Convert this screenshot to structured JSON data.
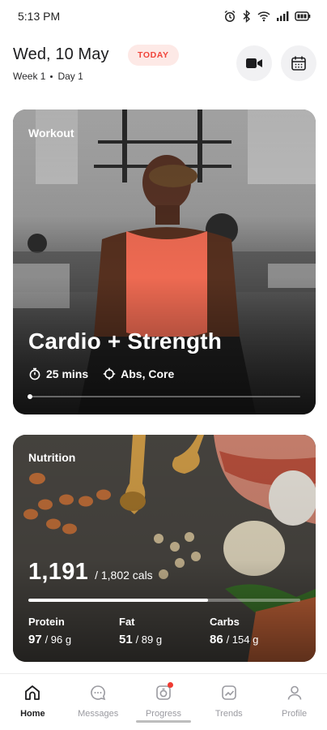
{
  "status_bar": {
    "time": "5:13 PM",
    "icons": [
      "alarm-icon",
      "bluetooth-icon",
      "wifi-icon",
      "signal-icon",
      "battery-icon"
    ]
  },
  "header": {
    "date": "Wed, 10 May",
    "badge": "TODAY",
    "week": "Week 1",
    "day": "Day 1",
    "buttons": [
      "video-camera-icon",
      "calendar-icon"
    ]
  },
  "workout": {
    "label": "Workout",
    "title": "Cardio + Strength",
    "duration": "25 mins",
    "target": "Abs, Core",
    "progress_fraction": 0.0
  },
  "nutrition": {
    "label": "Nutrition",
    "calories": "1,191",
    "goal": "/ 1,802 cals",
    "progress_fraction": 0.66,
    "macros": [
      {
        "label": "Protein",
        "value": "97",
        "goal": "/ 96 g"
      },
      {
        "label": "Fat",
        "value": "51",
        "goal": "/ 89 g"
      },
      {
        "label": "Carbs",
        "value": "86",
        "goal": "/ 154 g"
      }
    ]
  },
  "nav": [
    {
      "label": "Home",
      "icon": "home-icon",
      "active": true
    },
    {
      "label": "Messages",
      "icon": "chat-icon",
      "active": false
    },
    {
      "label": "Progress",
      "icon": "progress-icon",
      "active": false,
      "badge": true
    },
    {
      "label": "Trends",
      "icon": "trends-icon",
      "active": false
    },
    {
      "label": "Profile",
      "icon": "profile-icon",
      "active": false
    }
  ],
  "colors": {
    "accent": "#f0443a",
    "badge_bg": "#fde9e6",
    "workout_top": "#f6c7b5"
  }
}
